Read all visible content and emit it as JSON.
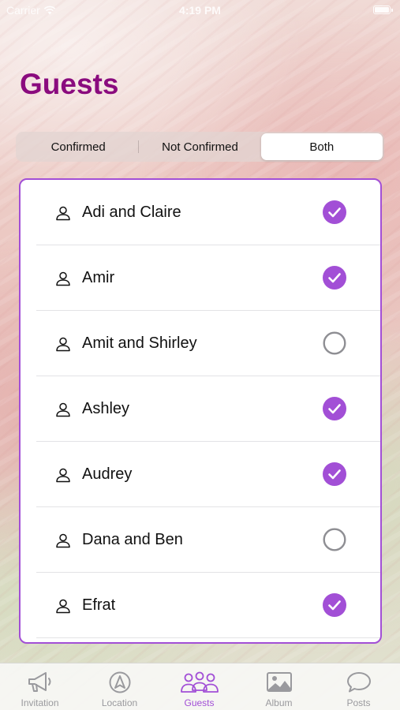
{
  "status_bar": {
    "carrier": "Carrier",
    "time": "4:19 PM"
  },
  "page_title": "Guests",
  "filter": {
    "segments": [
      {
        "label": "Confirmed",
        "selected": false
      },
      {
        "label": "Not Confirmed",
        "selected": false
      },
      {
        "label": "Both",
        "selected": true
      }
    ]
  },
  "guests": [
    {
      "name": "Adi and Claire",
      "confirmed": true
    },
    {
      "name": "Amir",
      "confirmed": true
    },
    {
      "name": "Amit and Shirley",
      "confirmed": false
    },
    {
      "name": "Ashley",
      "confirmed": true
    },
    {
      "name": "Audrey",
      "confirmed": true
    },
    {
      "name": "Dana and Ben",
      "confirmed": false
    },
    {
      "name": "Efrat",
      "confirmed": true
    }
  ],
  "tab_bar": {
    "tabs": [
      {
        "label": "Invitation",
        "icon": "megaphone-icon",
        "active": false
      },
      {
        "label": "Location",
        "icon": "navigation-arrow-icon",
        "active": false
      },
      {
        "label": "Guests",
        "icon": "people-icon",
        "active": true
      },
      {
        "label": "Album",
        "icon": "photo-icon",
        "active": false
      },
      {
        "label": "Posts",
        "icon": "speech-bubble-icon",
        "active": false
      }
    ]
  },
  "colors": {
    "title": "#8a0b7e",
    "accent": "#a24fd6",
    "unconfirmed_ring": "#8e8e93",
    "tab_inactive": "#9a9a9e"
  }
}
